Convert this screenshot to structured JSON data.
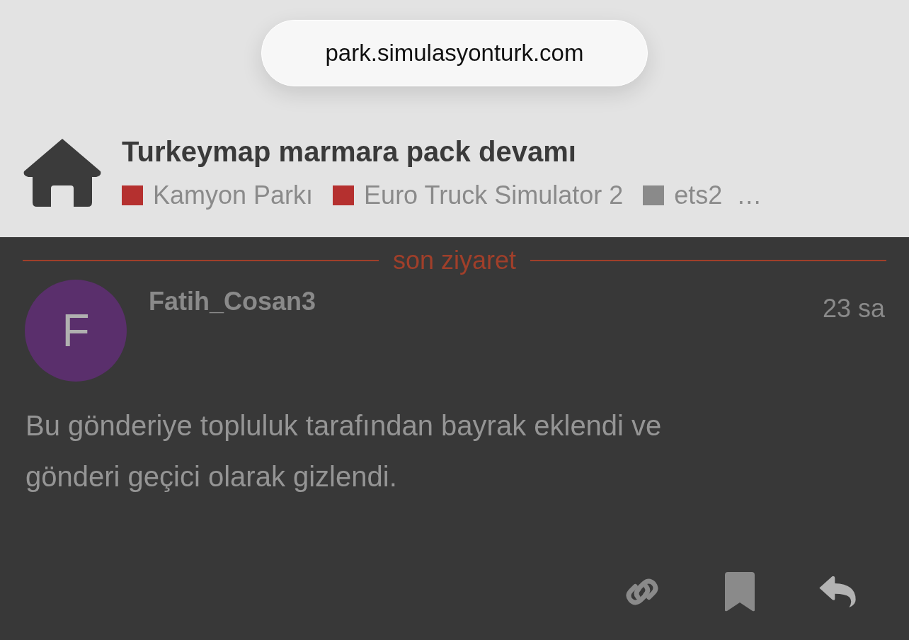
{
  "address_bar": {
    "url": "park.simulasyonturk.com"
  },
  "topic": {
    "title": "Turkeymap marmara pack devamı",
    "categories": [
      {
        "name": "Kamyon Parkı",
        "color": "#b5302f"
      },
      {
        "name": "Euro Truck Simulator 2",
        "color": "#b5302f"
      },
      {
        "name": "ets2",
        "color": "#8a8a8a"
      }
    ],
    "more": "…"
  },
  "divider": {
    "label": "son ziyaret"
  },
  "post": {
    "avatar_letter": "F",
    "author": "Fatih_Cosan3",
    "time": "23 sa",
    "body": "Bu gönderiye topluluk tarafından bayrak eklendi ve gönderi geçici olarak gizlendi."
  }
}
